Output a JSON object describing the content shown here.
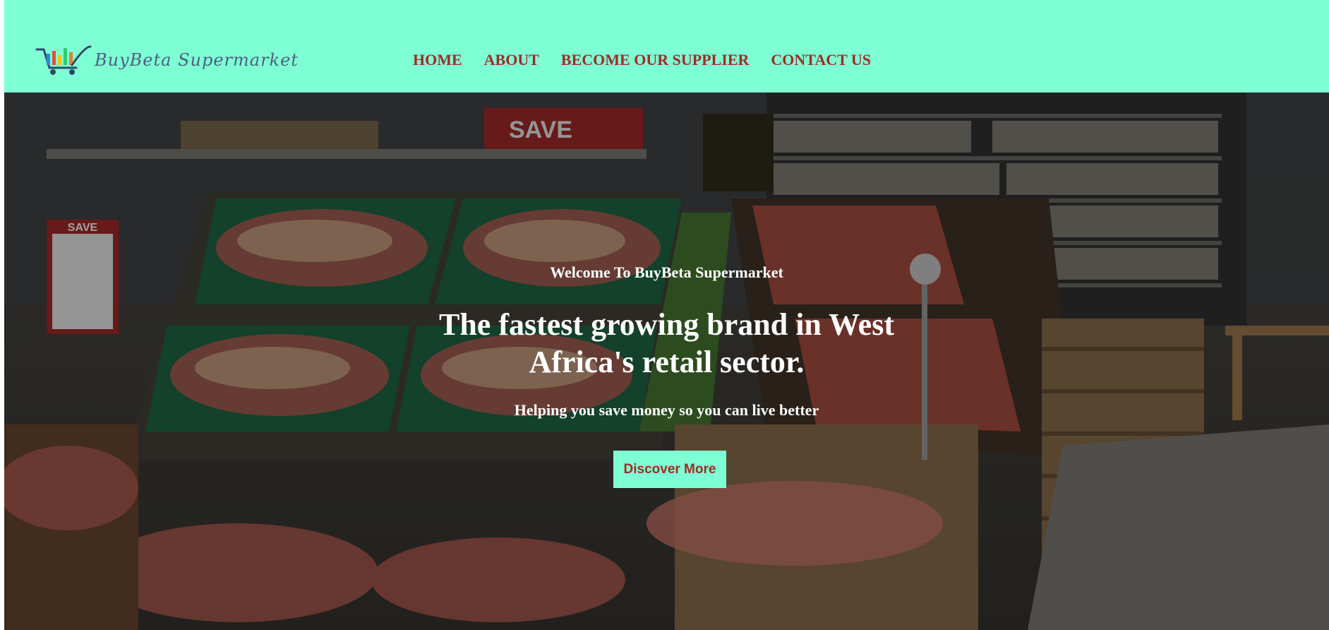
{
  "brand": {
    "name": "BuyBeta Supermarket",
    "logo_icon": "shopping-cart-icon"
  },
  "nav": {
    "items": [
      {
        "label": "HOME"
      },
      {
        "label": "ABOUT"
      },
      {
        "label": "BECOME OUR SUPPLIER"
      },
      {
        "label": "CONTACT US"
      }
    ]
  },
  "hero": {
    "welcome": "Welcome To BuyBeta Supermarket",
    "headline": "The fastest growing brand in West Africa's retail sector.",
    "subheadline": "Helping you save money so you can live better",
    "cta_label": "Discover More",
    "background_image": "supermarket-produce-aisle"
  },
  "colors": {
    "navbar_bg": "#7fffd4",
    "nav_text": "#a02a2a",
    "cta_bg": "#7fffd4",
    "cta_text": "#a02a2a"
  }
}
